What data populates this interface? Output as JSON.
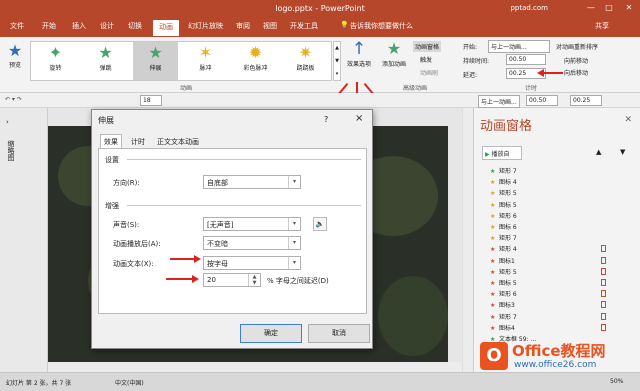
{
  "window": {
    "title": "logo.pptx - PowerPoint",
    "site": "pptad.com",
    "share": "共享",
    "tell_me": "告诉我你想要做什么"
  },
  "ribbon_tabs": [
    "文件",
    "开始",
    "插入",
    "设计",
    "切换",
    "动画",
    "幻灯片放映",
    "审阅",
    "视图",
    "开发工具"
  ],
  "active_tab": "动画",
  "ribbon": {
    "preview": "预览",
    "gallery": [
      {
        "label": "旋转",
        "icon": "star-spin-icon"
      },
      {
        "label": "弹跳",
        "icon": "star-bounce-icon"
      },
      {
        "label": "伸展",
        "icon": "star-stretch-icon"
      },
      {
        "label": "脉冲",
        "icon": "star-pulse-icon"
      },
      {
        "label": "彩色脉冲",
        "icon": "star-color-pulse-icon"
      },
      {
        "label": "跷跷板",
        "icon": "star-teeter-icon"
      }
    ],
    "group_animation": "动画",
    "effect_options": "效果选项",
    "add_animation": "添加动画",
    "group_advanced": "高级动画",
    "anim_pane": "动画窗格",
    "trigger": "触发",
    "anim_painter": "动画刷",
    "start_label": "开始:",
    "start_value": "与上一动画...",
    "duration_label": "持续时间:",
    "duration_value": "00.50",
    "delay_label": "延迟:",
    "delay_value": "00.25",
    "reorder": "对动画重新排序",
    "move_earlier": "向前移动",
    "move_later": "向后移动",
    "group_timing": "计时"
  },
  "qat": {
    "font_size": "18",
    "start_value": "与上一动画...",
    "duration": "00.50",
    "delay": "00.25"
  },
  "left_pane": {
    "label": "缩略图"
  },
  "dialog": {
    "title": "伸展",
    "help": "?",
    "close": "×",
    "tabs": [
      "效果",
      "计时",
      "正文文本动画"
    ],
    "settings_header": "设置",
    "direction_label": "方向(R):",
    "direction_value": "自底部",
    "enhance_header": "增强",
    "sound_label": "声音(S):",
    "sound_value": "[无声音]",
    "after_anim_label": "动画播放后(A):",
    "after_anim_value": "不变暗",
    "anim_text_label": "动画文本(X):",
    "anim_text_value": "按字母",
    "delay_value": "20",
    "delay_suffix": "% 字母之间延迟(D)",
    "ok": "确定",
    "cancel": "取消"
  },
  "anim_pane": {
    "title": "动画窗格",
    "play": "播放自",
    "items": [
      {
        "num": "",
        "name": "矩形 7",
        "color": "green"
      },
      {
        "num": "",
        "name": "图标 4",
        "color": "yellow"
      },
      {
        "num": "",
        "name": "矩形 5",
        "color": "yellow"
      },
      {
        "num": "",
        "name": "图标 5",
        "color": "yellow"
      },
      {
        "num": "",
        "name": "矩形 6",
        "color": "yellow"
      },
      {
        "num": "",
        "name": "图标 6",
        "color": "yellow"
      },
      {
        "num": "",
        "name": "矩形 7",
        "color": "yellow"
      },
      {
        "num": "",
        "name": "矩形 4",
        "color": "red"
      },
      {
        "num": "",
        "name": "图标1",
        "color": "red"
      },
      {
        "num": "",
        "name": "矩形 5",
        "color": "red"
      },
      {
        "num": "",
        "name": "图标 5",
        "color": "red"
      },
      {
        "num": "",
        "name": "矩形 6",
        "color": "red"
      },
      {
        "num": "",
        "name": "图标3",
        "color": "red"
      },
      {
        "num": "",
        "name": "矩形 7",
        "color": "red"
      },
      {
        "num": "",
        "name": "图标4",
        "color": "red"
      },
      {
        "num": "",
        "name": "文本框 59: ...",
        "color": "green"
      }
    ]
  },
  "status": {
    "slide": "幻灯片 第 2 张，共 7 张",
    "lang": "中文(中国)",
    "zoom": "50%"
  },
  "watermark": {
    "brand": "Office教程网",
    "url": "www.office26.com"
  },
  "colors": {
    "brand": "#b7472a",
    "arrow": "#e02020"
  }
}
